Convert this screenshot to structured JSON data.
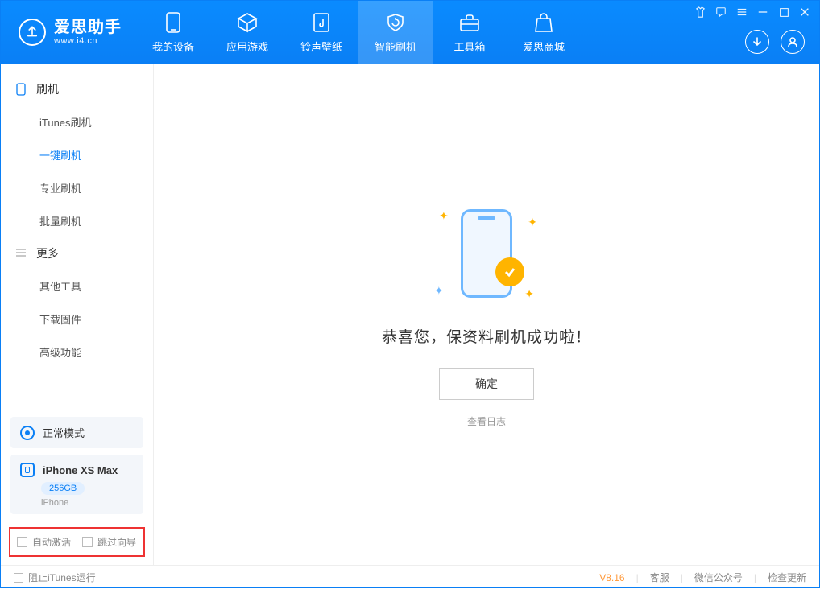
{
  "app": {
    "title": "爱思助手",
    "subtitle": "www.i4.cn"
  },
  "nav": {
    "my_device": "我的设备",
    "apps_games": "应用游戏",
    "ringtones": "铃声壁纸",
    "smart_flash": "智能刷机",
    "toolbox": "工具箱",
    "store": "爱思商城"
  },
  "sidebar": {
    "section_flash": "刷机",
    "items_flash": {
      "itunes": "iTunes刷机",
      "onekey": "一键刷机",
      "pro": "专业刷机",
      "batch": "批量刷机"
    },
    "section_more": "更多",
    "items_more": {
      "other_tools": "其他工具",
      "download_fw": "下载固件",
      "advanced": "高级功能"
    },
    "mode_label": "正常模式",
    "device_name": "iPhone XS Max",
    "device_capacity": "256GB",
    "device_type": "iPhone",
    "checkbox_auto_activate": "自动激活",
    "checkbox_skip_guide": "跳过向导"
  },
  "main": {
    "success_message": "恭喜您，保资料刷机成功啦！",
    "ok_button": "确定",
    "view_log": "查看日志"
  },
  "statusbar": {
    "block_itunes": "阻止iTunes运行",
    "version": "V8.16",
    "support": "客服",
    "wechat": "微信公众号",
    "check_update": "检查更新"
  }
}
